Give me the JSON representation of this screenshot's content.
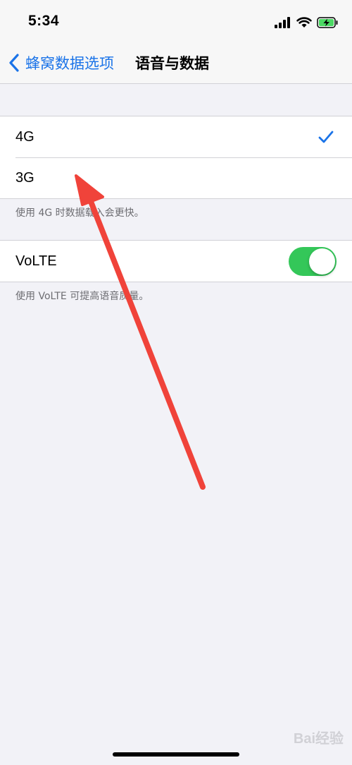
{
  "status_bar": {
    "time": "5:34",
    "icons": [
      "signal-icon",
      "wifi-icon",
      "battery-charging-icon"
    ]
  },
  "nav": {
    "back_label": "蜂窝数据选项",
    "title": "语音与数据"
  },
  "network_group": {
    "items": [
      {
        "label": "4G",
        "selected": true
      },
      {
        "label": "3G",
        "selected": false
      }
    ],
    "footer": "使用 4G 时数据载入会更快。"
  },
  "volte_group": {
    "label": "VoLTE",
    "enabled": true,
    "footer": "使用 VoLTE 可提高语音质量。"
  },
  "colors": {
    "accent": "#1A73E8",
    "toggle_on": "#34C759",
    "annotation_arrow": "#F0433A",
    "background": "#F2F2F7"
  },
  "watermark": "Bai经验"
}
